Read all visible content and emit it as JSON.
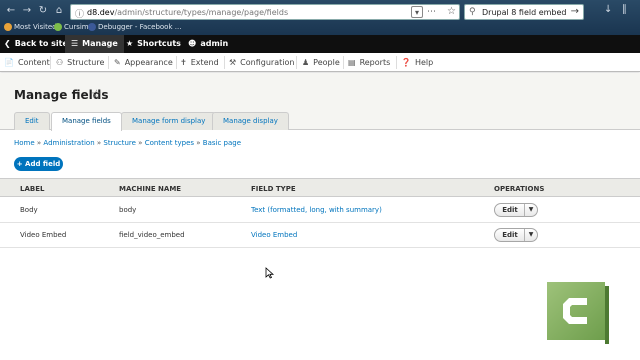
{
  "browser": {
    "url_host": "d8.dev",
    "url_path": "/admin/structure/types/manage/page/fields",
    "search_text": "Drupal 8 field embed",
    "bookmarks": [
      {
        "label": "Most Visited",
        "color": "#e8a33a"
      },
      {
        "label": "Cursimd",
        "color": "#7dbd4a"
      },
      {
        "label": "Debugger - Facebook ...",
        "color": "#3b5998"
      }
    ]
  },
  "toolbar": {
    "back_label": "Back to site",
    "manage_label": "Manage",
    "shortcuts_label": "Shortcuts",
    "user_label": "admin"
  },
  "tray": {
    "items": [
      {
        "label": "Content",
        "icon": "file-icon"
      },
      {
        "label": "Structure",
        "icon": "structure-icon"
      },
      {
        "label": "Appearance",
        "icon": "paintbrush-icon"
      },
      {
        "label": "Extend",
        "icon": "puzzle-icon"
      },
      {
        "label": "Configuration",
        "icon": "wrench-icon"
      },
      {
        "label": "People",
        "icon": "people-icon"
      },
      {
        "label": "Reports",
        "icon": "reports-icon"
      },
      {
        "label": "Help",
        "icon": "help-icon"
      }
    ]
  },
  "page": {
    "title": "Manage fields",
    "tabs": [
      "Edit",
      "Manage fields",
      "Manage form display",
      "Manage display"
    ],
    "active_tab": "Manage fields"
  },
  "breadcrumb": [
    "Home",
    "Administration",
    "Structure",
    "Content types",
    "Basic page"
  ],
  "add_field_label": "+ Add field",
  "table": {
    "headers": [
      "LABEL",
      "MACHINE NAME",
      "FIELD TYPE",
      "OPERATIONS"
    ],
    "rows": [
      {
        "label": "Body",
        "machine_name": "body",
        "field_type": "Text (formatted, long, with summary)",
        "operation": "Edit"
      },
      {
        "label": "Video Embed",
        "machine_name": "field_video_embed",
        "field_type": "Video Embed",
        "operation": "Edit"
      }
    ]
  },
  "colors": {
    "link": "#0074bd",
    "toolbar_bg": "#0f0f0f",
    "add_button": "#0074bd",
    "header_bg": "#f5f5f2"
  }
}
